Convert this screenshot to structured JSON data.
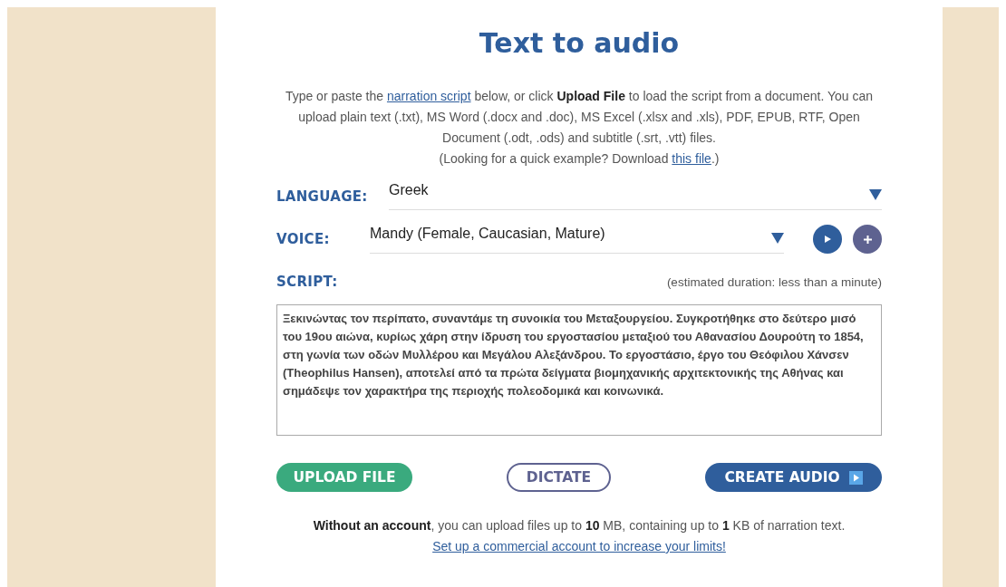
{
  "title": "Text to audio",
  "intro": [
    {
      "kind": "text",
      "text": "Type or paste the "
    },
    {
      "kind": "link",
      "text": "narration script"
    },
    {
      "kind": "text",
      "text": " below, or click **Upload File** to load the script from a document. You can upload plain text (.txt), MS Word (.docx and .doc), MS Excel (.xlsx and .xls), PDF, EPUB, RTF, Open Document (.odt, .ods) and subtitle (.srt, .vtt) files."
    }
  ],
  "example": [
    {
      "kind": "text",
      "text": "(Looking for a quick example? Download "
    },
    {
      "kind": "link",
      "text": "this file"
    },
    {
      "kind": "text",
      "text": ".)"
    }
  ],
  "language": {
    "label": "LANGUAGE:",
    "value": "Greek"
  },
  "voice": {
    "label": "VOICE:",
    "value": "Mandy (Female, Caucasian, Mature)"
  },
  "script": {
    "label": "SCRIPT:",
    "duration": "(estimated duration: less than a minute)",
    "value": "Ξεκινώντας τον περίπατο, συναντάμε τη συνοικία του Μεταξουργείου. Συγκροτήθηκε στο δεύτερο μισό του 19ου αιώνα, κυρίως χάρη στην ίδρυση του εργοστασίου μεταξιού του Αθανασίου Δουρούτη το 1854, στη γωνία των οδών Μυλλέρου και Μεγάλου Αλεξάνδρου. Το εργοστάσιο, έργο του Θεόφιλου Χάνσεν (Theophilus Hansen), αποτελεί από τα πρώτα δείγματα βιομηχανικής αρχιτεκτονικής της Αθήνας και σημάδεψε τον χαρακτήρα της περιοχής πολεοδομικά και κοινωνικά."
  },
  "buttons": [
    {
      "kind": "upload",
      "label": "UPLOAD FILE"
    },
    {
      "kind": "dictate",
      "label": "DICTATE"
    },
    {
      "kind": "create",
      "label": "CREATE AUDIO"
    }
  ],
  "limits": "**Without an account**, you can upload files up to **10** MB, containing up to **1** KB of narration text.",
  "upgrade_link": "Set up a commercial account to increase your limits!"
}
